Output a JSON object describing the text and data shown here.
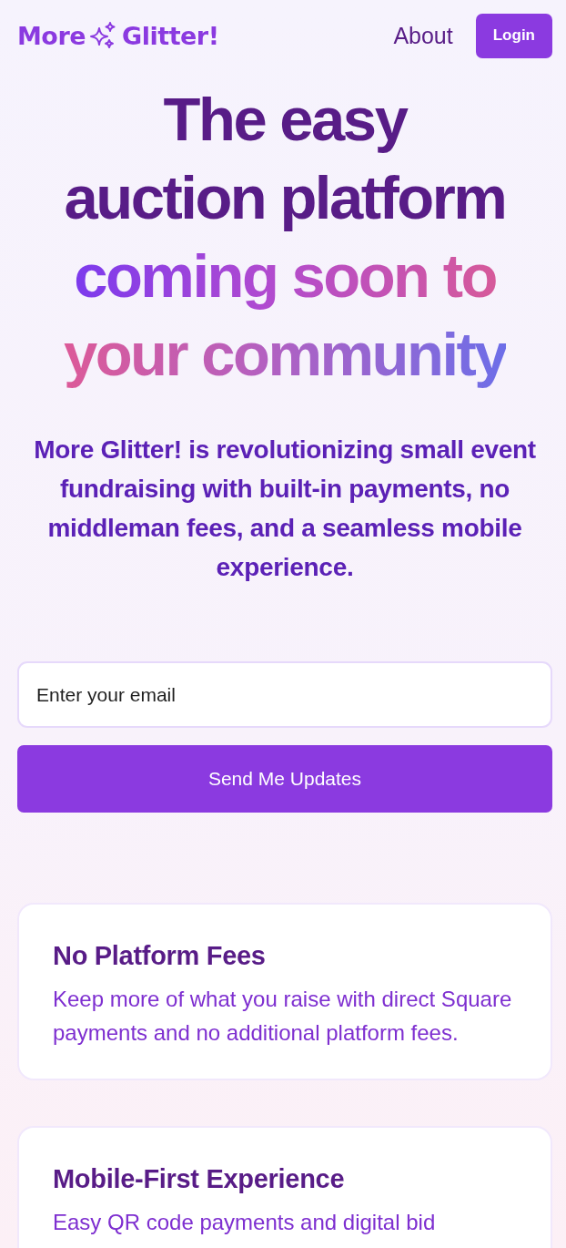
{
  "nav": {
    "logo_left": "More",
    "logo_right": "Glitter!",
    "links": [
      {
        "label": "About",
        "kind": "link"
      },
      {
        "label": "Login",
        "kind": "button"
      }
    ]
  },
  "hero": {
    "headline": [
      {
        "text": "The easy",
        "kind": "plain"
      },
      {
        "text": "auction platform",
        "kind": "plain"
      },
      {
        "text": "coming soon to",
        "kind": "gradient-warm"
      },
      {
        "text": "your community",
        "kind": "gradient-cool"
      }
    ],
    "subtitle": "More Glitter! is revolutionizing small event fundraising with built-in payments, no middleman fees, and a seamless mobile experience."
  },
  "signup": {
    "placeholder": "Enter your email",
    "button": "Send Me Updates"
  },
  "features": [
    {
      "title": "No Platform Fees",
      "description": "Keep more of what you raise with direct Square payments and no additional platform fees."
    },
    {
      "title": "Mobile-First Experience",
      "description": "Easy QR code payments and digital bid"
    }
  ]
}
